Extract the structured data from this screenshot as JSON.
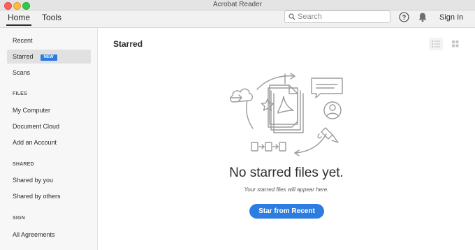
{
  "window": {
    "title": "Acrobat Reader"
  },
  "topnav": {
    "tabs": [
      {
        "label": "Home"
      },
      {
        "label": "Tools"
      }
    ],
    "search_placeholder": "Search",
    "signin_label": "Sign In"
  },
  "sidebar": {
    "recent": "Recent",
    "starred": "Starred",
    "starred_badge": "NEW",
    "scans": "Scans",
    "files_header": "FILES",
    "my_computer": "My Computer",
    "document_cloud": "Document Cloud",
    "add_account": "Add an Account",
    "shared_header": "SHARED",
    "shared_by_you": "Shared by you",
    "shared_by_others": "Shared by others",
    "sign_header": "SIGN",
    "all_agreements": "All Agreements"
  },
  "main": {
    "page_title": "Starred",
    "empty_title": "No starred files yet.",
    "empty_subtitle": "Your starred files will appear here.",
    "cta_label": "Star from Recent"
  },
  "colors": {
    "accent": "#2d7ce0",
    "selected_bg": "#e1e1e1",
    "illustration": "#9b9b9b"
  },
  "icons": [
    "search-icon",
    "help-icon",
    "bell-icon",
    "list-view-icon",
    "grid-view-icon"
  ]
}
